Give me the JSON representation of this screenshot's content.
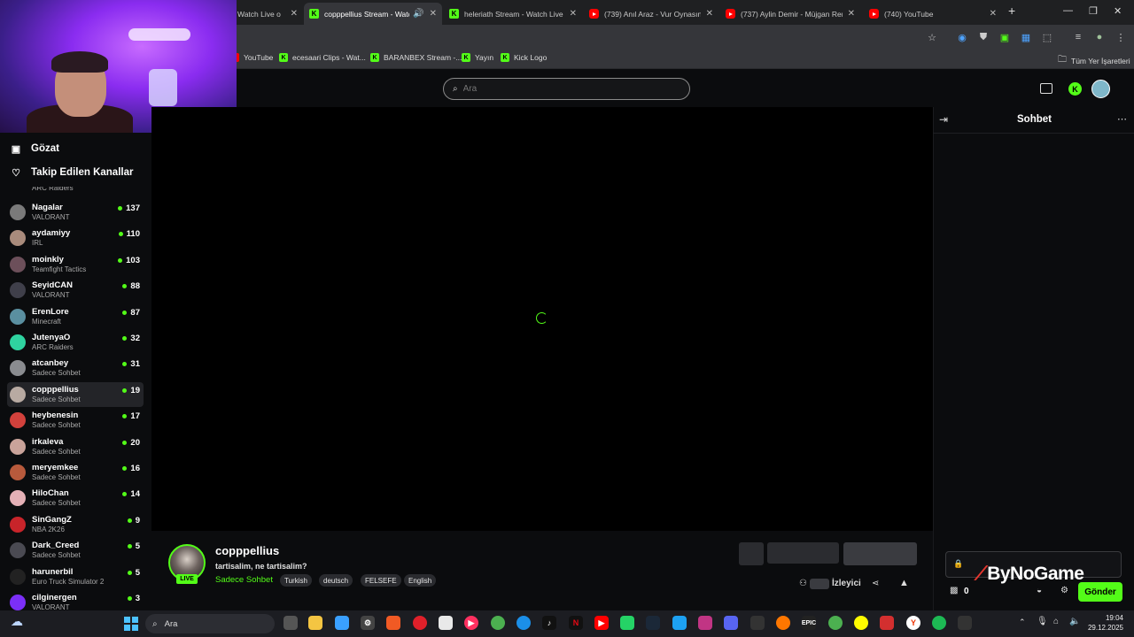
{
  "browser": {
    "tabs": [
      {
        "title": "Watch Live o",
        "icon": "kick-icon"
      },
      {
        "title": "copppellius Stream - Watch",
        "icon": "kick-icon"
      },
      {
        "title": "heleriath Stream - Watch Live o",
        "icon": "kick-icon"
      },
      {
        "title": "(739) Anıl Araz - Vur Oynasın Tı",
        "icon": "youtube-icon"
      },
      {
        "title": "(737) Aylin Demir - Müjgan Ren",
        "icon": "youtube-icon"
      },
      {
        "title": "(740) YouTube",
        "icon": "youtube-icon"
      }
    ],
    "bookmarks": [
      {
        "label": "YouTube"
      },
      {
        "label": "ecesaari Clips - Wat..."
      },
      {
        "label": "BARANBEX Stream -..."
      },
      {
        "label": "Yayın"
      },
      {
        "label": "Kick Logo"
      }
    ],
    "all_bookmarks_label": "Tüm Yer İşaretleri"
  },
  "header": {
    "search_placeholder": "Ara"
  },
  "sidebar": {
    "browse_label": "Gözat",
    "following_label": "Takip Edilen Kanallar",
    "partial_category": "ARC Raiders",
    "channels": [
      {
        "name": "Nagalar",
        "category": "VALORANT",
        "viewers": "137",
        "color": "#7a7a7a"
      },
      {
        "name": "aydamiyy",
        "category": "IRL",
        "viewers": "110",
        "color": "#a98b7c"
      },
      {
        "name": "moinkly",
        "category": "Teamfight Tactics",
        "viewers": "103",
        "color": "#6c4f5a"
      },
      {
        "name": "SeyidCAN",
        "category": "VALORANT",
        "viewers": "88",
        "color": "#3f3f4a"
      },
      {
        "name": "ErenLore",
        "category": "Minecraft",
        "viewers": "87",
        "color": "#5a8fa0"
      },
      {
        "name": "JutenyaO",
        "category": "ARC Raiders",
        "viewers": "32",
        "color": "#2fd3a0"
      },
      {
        "name": "atcanbey",
        "category": "Sadece Sohbet",
        "viewers": "31",
        "color": "#8a8c90"
      },
      {
        "name": "copppellius",
        "category": "Sadece Sohbet",
        "viewers": "19",
        "color": "#b8aaa2"
      },
      {
        "name": "heybenesin",
        "category": "Sadece Sohbet",
        "viewers": "17",
        "color": "#d2413c"
      },
      {
        "name": "irkaleva",
        "category": "Sadece Sohbet",
        "viewers": "20",
        "color": "#c9a39a"
      },
      {
        "name": "meryemkee",
        "category": "Sadece Sohbet",
        "viewers": "16",
        "color": "#b85a3c"
      },
      {
        "name": "HiloChan",
        "category": "Sadece Sohbet",
        "viewers": "14",
        "color": "#e4b0b6"
      },
      {
        "name": "SinGangZ",
        "category": "NBA 2K26",
        "viewers": "9",
        "color": "#c8242a"
      },
      {
        "name": "Dark_Creed",
        "category": "Sadece Sohbet",
        "viewers": "5",
        "color": "#4a4a52"
      },
      {
        "name": "harunerbil",
        "category": "Euro Truck Simulator 2",
        "viewers": "5",
        "color": "#222"
      },
      {
        "name": "cilginergen",
        "category": "VALORANT",
        "viewers": "3",
        "color": "#7b2ff7"
      }
    ],
    "active_channel": "copppellius"
  },
  "stream": {
    "channel": "copppellius",
    "title": "tartisalim, ne tartisalim?",
    "category": "Sadece Sohbet",
    "live_label": "LIVE",
    "tags": [
      "Turkish",
      "deutsch",
      "FELSEFE",
      "English"
    ],
    "viewers_label": "İzleyici"
  },
  "chat": {
    "title": "Sohbet",
    "send_label": "Gönder",
    "points": "0",
    "overlay_watermark": "ByNoGame"
  },
  "taskbar": {
    "search_label": "Ara",
    "time": "19:04",
    "date": "29.12.2025"
  },
  "colors": {
    "kick_green": "#53fc18",
    "background": "#0b0c0e",
    "youtube_red": "#ff0000"
  }
}
